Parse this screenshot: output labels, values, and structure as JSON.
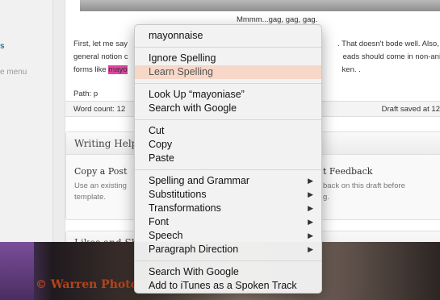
{
  "sidebar": {
    "link_text": "s",
    "menu_text": "e menu"
  },
  "editor": {
    "caption": "Mmmm...gag, gag, gag.",
    "lines": [
      {
        "before": "First, let me say",
        "highlight": "",
        "after": "",
        "tail": ". That doesn't bode well. Also, t"
      },
      {
        "before": "general notion c",
        "highlight": "",
        "after": "",
        "tail": "eads should come in non-anim"
      },
      {
        "before": "forms like ",
        "highlight": "mayo",
        "after": "",
        "tail": "ken. ."
      }
    ],
    "path_label": "Path: p",
    "word_count": "Word count: 12",
    "draft_saved": "Draft saved at 12"
  },
  "writing_box": {
    "title": "Writing Help",
    "copy_post_title": "Copy a Post",
    "copy_post_desc_1": "Use an existing",
    "copy_post_desc_2": "template.",
    "feedback_title": "t Feedback",
    "feedback_desc_1": "back on this draft before",
    "feedback_desc_2": "g."
  },
  "likes_box": {
    "title": "Likes and Sh"
  },
  "watermark": "© Warren Photographics",
  "context_menu": {
    "word": "mayonnaise",
    "group1": [
      "Ignore Spelling",
      "Learn Spelling"
    ],
    "group2": [
      "Look Up “mayoniase”",
      "Search with Google"
    ],
    "group3": [
      "Cut",
      "Copy",
      "Paste"
    ],
    "group4": [
      "Spelling and Grammar",
      "Substitutions",
      "Transformations",
      "Font",
      "Speech",
      "Paragraph Direction"
    ],
    "group5": [
      "Search With Google",
      "Add to iTunes as a Spoken Track"
    ],
    "hovered_item": "Learn Spelling"
  }
}
